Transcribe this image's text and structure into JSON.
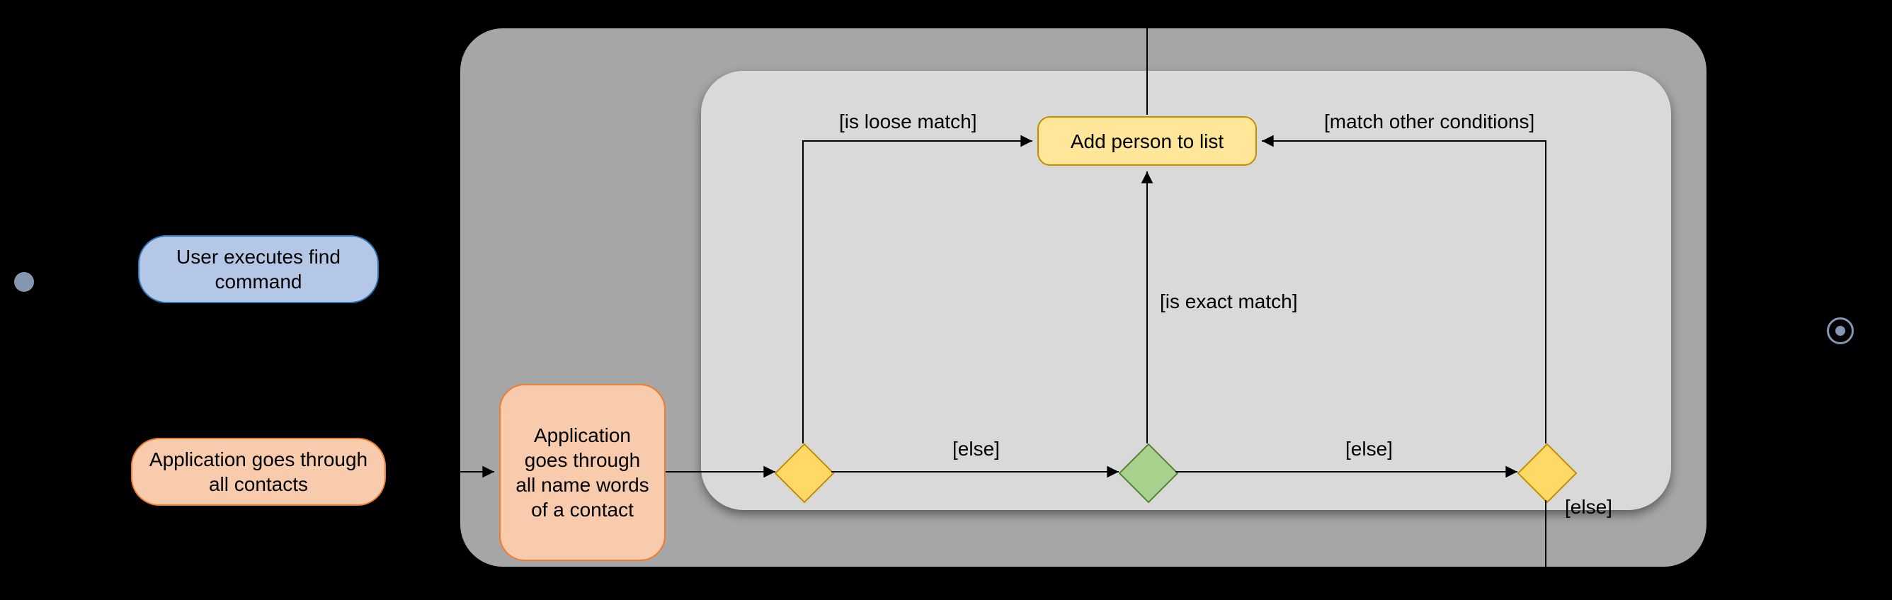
{
  "nodes": {
    "user_exec": "User executes find command",
    "through_contacts": "Application goes through all contacts",
    "through_words": "Application goes through all name words of a contact",
    "add_person": "Add person to list"
  },
  "guards": {
    "loose": "[is loose match]",
    "exact": "[is exact match]",
    "other": "[match other conditions]",
    "else1": "[else]",
    "else2": "[else]",
    "else3": "[else]"
  },
  "colors": {
    "panel_outer": "#a6a6a6",
    "panel_inner": "#d9d9d9",
    "blue_fill": "#b4c7e7",
    "orange_fill": "#f8cbad",
    "yellow_fill": "#ffe699",
    "diamond_yellow": "#ffd966",
    "diamond_green": "#a9d18e"
  }
}
